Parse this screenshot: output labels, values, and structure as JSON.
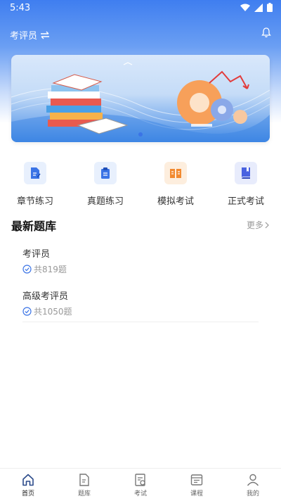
{
  "status_bar": {
    "time": "5:43"
  },
  "header": {
    "title": "考评员",
    "switch_icon": "swap-icon",
    "bell_icon": "bell-icon"
  },
  "banner": {
    "slides": 2,
    "active_index": 0
  },
  "quick_actions": [
    {
      "label": "章节练习",
      "icon": "edit-doc-icon",
      "color": "#3b74e6",
      "bg": "#e8f0fd"
    },
    {
      "label": "真题练习",
      "icon": "clipboard-icon",
      "color": "#3b74e6",
      "bg": "#e8f0fd"
    },
    {
      "label": "模拟考试",
      "icon": "open-book-icon",
      "color": "#f28a30",
      "bg": "#fdeede"
    },
    {
      "label": "正式考试",
      "icon": "book-icon",
      "color": "#4a63e0",
      "bg": "#e8ecfc"
    }
  ],
  "latest": {
    "title": "最新题库",
    "more": "更多",
    "items": [
      {
        "name": "考评员",
        "count": "共819题"
      },
      {
        "name": "高级考评员",
        "count": "共1050题"
      }
    ]
  },
  "tabbar": [
    {
      "label": "首页",
      "icon": "home-icon",
      "active": true
    },
    {
      "label": "题库",
      "icon": "question-bank-icon",
      "active": false
    },
    {
      "label": "考试",
      "icon": "exam-icon",
      "active": false
    },
    {
      "label": "课程",
      "icon": "course-icon",
      "active": false
    },
    {
      "label": "我的",
      "icon": "profile-icon",
      "active": false
    }
  ]
}
